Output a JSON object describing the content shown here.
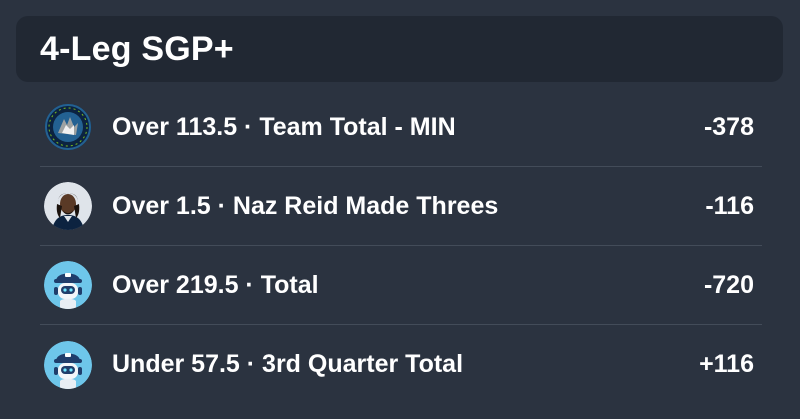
{
  "header": {
    "title": "4-Leg SGP+"
  },
  "legs": [
    {
      "description": "Over 113.5 · Team Total - MIN",
      "odds": "-378",
      "icon": "timberwolves-logo-icon"
    },
    {
      "description": "Over 1.5 · Naz Reid Made Threes",
      "odds": "-116",
      "icon": "player-headshot-icon"
    },
    {
      "description": "Over 219.5 · Total",
      "odds": "-720",
      "icon": "robot-mascot-icon"
    },
    {
      "description": "Under 57.5 · 3rd Quarter Total",
      "odds": "+116",
      "icon": "robot-mascot-icon"
    }
  ],
  "colors": {
    "background": "#2b3340",
    "header_background": "#212833",
    "divider": "#434c59",
    "text": "#ffffff"
  }
}
